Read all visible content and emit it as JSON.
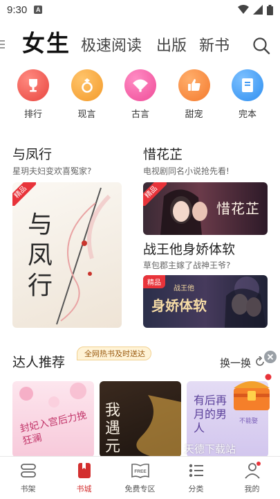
{
  "status_bar": {
    "time": "9:30",
    "notification_letter": "A"
  },
  "top_tabs": {
    "active": "女生",
    "others": [
      "极速阅读",
      "出版",
      "新书"
    ]
  },
  "categories": [
    {
      "label": "排行",
      "icon": "trophy-icon",
      "color": "#ef5b57"
    },
    {
      "label": "现言",
      "icon": "ring-icon",
      "color": "#f7a13a"
    },
    {
      "label": "古言",
      "icon": "fan-icon",
      "color": "#f45aa0"
    },
    {
      "label": "甜宠",
      "icon": "thumbs-up-icon",
      "color": "#f7833a"
    },
    {
      "label": "完本",
      "icon": "book-icon",
      "color": "#3f9bf2"
    }
  ],
  "featured": {
    "left": {
      "title": "与凤行",
      "subtitle": "星玥夫妇变欢喜冤家?",
      "badge": "精品",
      "cover_title": "与凤行"
    },
    "right_top": {
      "title": "惜花芷",
      "subtitle": "电视剧同名小说抢先看!",
      "badge": "精品",
      "cover_title": "惜花芷"
    },
    "right_bottom": {
      "title": "战王他身娇体软",
      "subtitle": "草包郡主嫁了战神王爷?",
      "badge": "精品",
      "cover_title": "身娇体软",
      "cover_small": "战王他"
    }
  },
  "recommendation": {
    "title": "达人推荐",
    "tag": "全网热书及时送达",
    "refresh_label": "换一换",
    "books": [
      {
        "cover_text": "封妃入宫后力挽狂澜"
      },
      {
        "cover_text": "我遇元宝"
      },
      {
        "cover_text": "有后再月的男人",
        "cover_sub": "不能娶"
      }
    ],
    "overlay_text": "天德下载站"
  },
  "bottom_nav": [
    {
      "label": "书架",
      "icon": "bookshelf-icon",
      "active": false
    },
    {
      "label": "书城",
      "icon": "bookstore-icon",
      "active": true
    },
    {
      "label": "免费专区",
      "icon": "free-icon",
      "active": false,
      "icon_text": "FREE"
    },
    {
      "label": "分类",
      "icon": "category-list-icon",
      "active": false
    },
    {
      "label": "我的",
      "icon": "profile-icon",
      "active": false
    }
  ],
  "colors": {
    "accent": "#d32f2f",
    "badge": "#e8333a"
  }
}
